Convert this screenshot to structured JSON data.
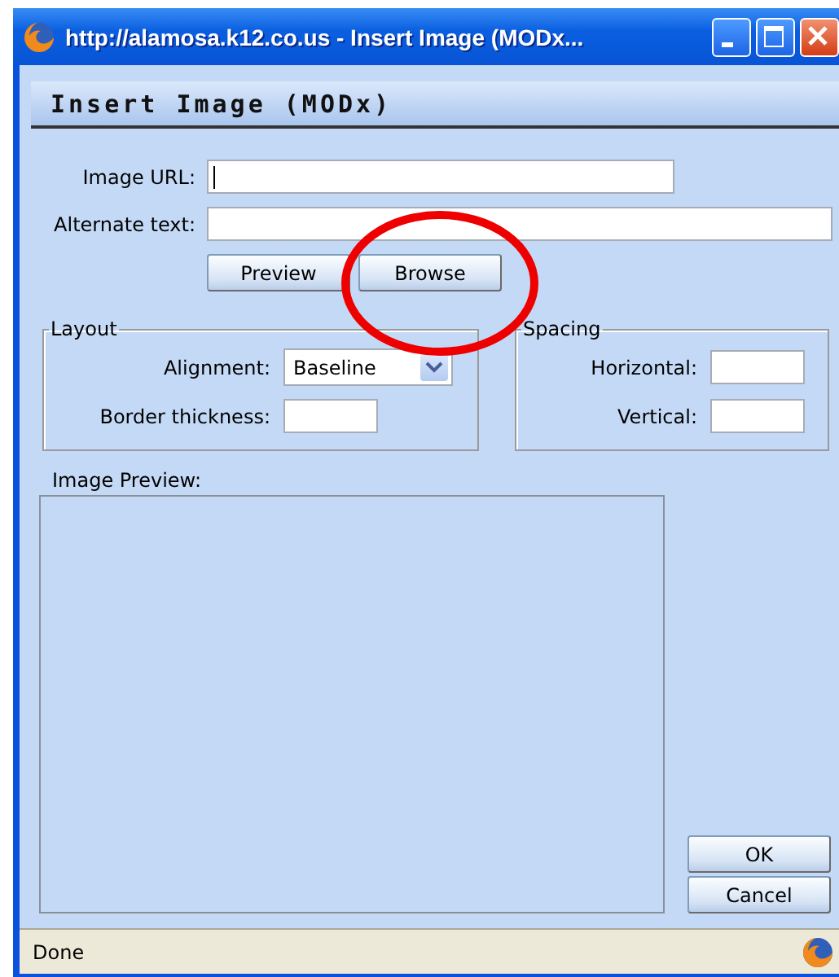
{
  "window": {
    "title": "http://alamosa.k12.co.us - Insert Image (MODx..."
  },
  "dialog": {
    "heading": "Insert Image (MODx)",
    "image_url": {
      "label": "Image URL:",
      "focused": true
    },
    "alternate_text": {
      "label": "Alternate text:"
    },
    "buttons": [
      "Preview",
      "Browse"
    ],
    "layout": {
      "legend": "Layout",
      "alignment": {
        "label": "Alignment:",
        "value": "Baseline"
      },
      "border_thickness": {
        "label": "Border thickness:"
      }
    },
    "spacing": {
      "legend": "Spacing",
      "horizontal": {
        "label": "Horizontal:"
      },
      "vertical": {
        "label": "Vertical:"
      }
    },
    "preview": {
      "label": "Image Preview:"
    },
    "actions": [
      "OK",
      "Cancel"
    ]
  },
  "annotation": {
    "kind": "ellipse"
  },
  "status_bar": {
    "text": "Done"
  }
}
